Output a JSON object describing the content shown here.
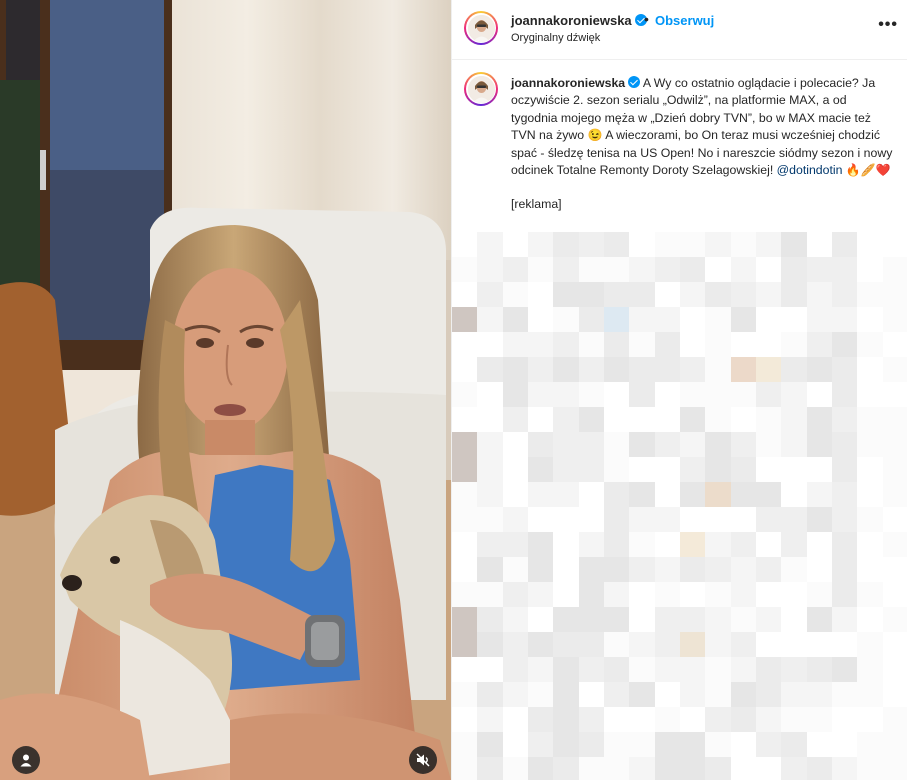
{
  "post": {
    "username": "joannakoroniewska",
    "follow_label": "Obserwuj",
    "separator": "•",
    "audio_label": "Oryginalny dźwięk",
    "more_label": "•••"
  },
  "caption": {
    "username": "joannakoroniewska",
    "text_part1": " A Wy co ostatnio oglądacie i polecacie? Ja oczywiście 2. sezon serialu „Odwilż”, na platformie MAX, a od tygodnia mojego męża w „Dzień dobry TVN”, bo w MAX macie też TVN na żywo ",
    "emoji_wink": "😉",
    "text_part2": " A wieczorami, bo On teraz musi wcześniej chodzić spać - śledzę tenisa na US Open! No i nareszcie siódmy sezon i nowy odcinek Totalne Remonty Doroty Szelagowskiej! ",
    "mention": "@dotindotin",
    "emojis_end": "🔥🥖❤️",
    "ad_tag": "[reklama]"
  },
  "icons": {
    "verified": "verified-badge-icon",
    "tag": "person-tag-icon",
    "mute": "speaker-muted-icon",
    "more": "more-options-icon"
  },
  "colors": {
    "link_blue": "#0095f6",
    "mention_blue": "#00376b",
    "text": "#262626",
    "divider": "#efefef"
  }
}
